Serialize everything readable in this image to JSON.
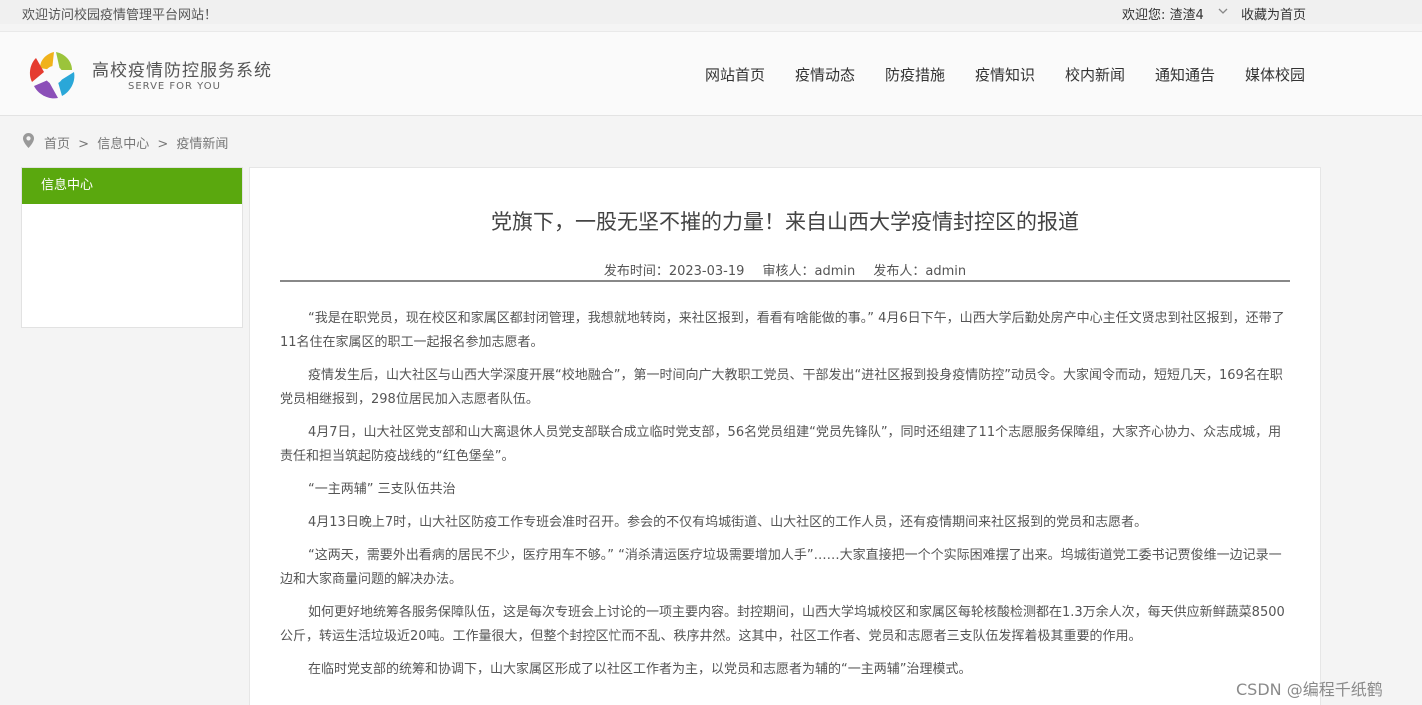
{
  "topbar": {
    "welcome": "欢迎访问校园疫情管理平台网站！",
    "user": "欢迎您: 渣渣4",
    "favorite": "收藏为首页"
  },
  "header": {
    "title": "高校疫情防控服务系统",
    "subtitle": "SERVE FOR YOU",
    "nav": [
      "网站首页",
      "疫情动态",
      "防疫措施",
      "疫情知识",
      "校内新闻",
      "通知通告",
      "媒体校园"
    ]
  },
  "breadcrumb": {
    "items": [
      "首页",
      "信息中心",
      "疫情新闻"
    ],
    "separator": ">"
  },
  "sidebar": {
    "heading": "信息中心"
  },
  "article": {
    "title": "党旗下，一股无坚不摧的力量！来自山西大学疫情封控区的报道",
    "publish_time": "发布时间：2023-03-19",
    "reviewer": "审核人：admin",
    "publisher": "发布人：admin",
    "paragraphs": [
      "“我是在职党员，现在校区和家属区都封闭管理，我想就地转岗，来社区报到，看看有啥能做的事。” 4月6日下午，山西大学后勤处房产中心主任文贤忠到社区报到，还带了11名住在家属区的职工一起报名参加志愿者。",
      "疫情发生后，山大社区与山西大学深度开展“校地融合”，第一时间向广大教职工党员、干部发出“进社区报到投身疫情防控”动员令。大家闻令而动，短短几天，169名在职党员相继报到，298位居民加入志愿者队伍。",
      "4月7日，山大社区党支部和山大离退休人员党支部联合成立临时党支部，56名党员组建“党员先锋队”，同时还组建了11个志愿服务保障组，大家齐心协力、众志成城，用责任和担当筑起防疫战线的“红色堡垒”。",
      "“一主两辅” 三支队伍共治",
      "4月13日晚上7时，山大社区防疫工作专班会准时召开。参会的不仅有坞城街道、山大社区的工作人员，还有疫情期间来社区报到的党员和志愿者。",
      "“这两天，需要外出看病的居民不少，医疗用车不够。” “消杀清运医疗垃圾需要增加人手”……大家直接把一个个实际困难摆了出来。坞城街道党工委书记贾俊维一边记录一边和大家商量问题的解决办法。",
      "如何更好地统筹各服务保障队伍，这是每次专班会上讨论的一项主要内容。封控期间，山西大学坞城校区和家属区每轮核酸检测都在1.3万余人次，每天供应新鲜蔬菜8500公斤，转运生活垃圾近20吨。工作量很大，但整个封控区忙而不乱、秩序井然。这其中，社区工作者、党员和志愿者三支队伍发挥着极其重要的作用。",
      "在临时党支部的统筹和协调下，山大家属区形成了以社区工作者为主，以党员和志愿者为辅的“一主两辅”治理模式。"
    ]
  },
  "watermark": "CSDN @编程千纸鹤",
  "colors": {
    "accent": "#5aa80e",
    "rule": "#888888"
  },
  "icons": {
    "location": "map-pin-icon",
    "dropdown": "chevron-down-icon",
    "logo": "pinwheel-logo-icon"
  }
}
